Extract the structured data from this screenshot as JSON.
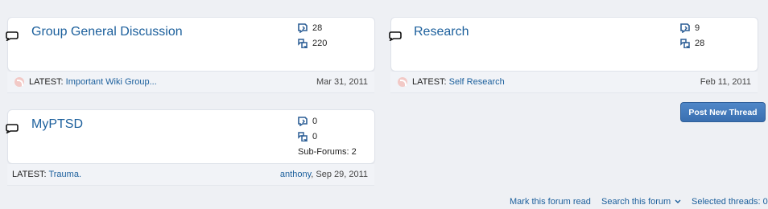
{
  "forums": [
    {
      "title": "Group General Discussion",
      "threads": "28",
      "posts": "220",
      "latest_label": "LATEST:",
      "latest_link": "Important Wiki Group...",
      "latest_by": "",
      "date": "Mar 31, 2011"
    },
    {
      "title": "Research",
      "threads": "9",
      "posts": "28",
      "latest_label": "LATEST:",
      "latest_link": "Self Research",
      "latest_by": "",
      "date": "Feb 11, 2011"
    },
    {
      "title": "MyPTSD",
      "threads": "0",
      "posts": "0",
      "subforums": "Sub-Forums: 2",
      "latest_label": "LATEST:",
      "latest_link": "Trauma.",
      "latest_by": "anthony",
      "date": ", Sep 29, 2011"
    }
  ],
  "post_new_thread": "Post New Thread",
  "footer": {
    "mark_read": "Mark this forum read",
    "search": "Search this forum",
    "selected": "Selected threads: 0"
  },
  "colors": {
    "link": "#1b5f9c",
    "button": "#3a6fb0"
  }
}
